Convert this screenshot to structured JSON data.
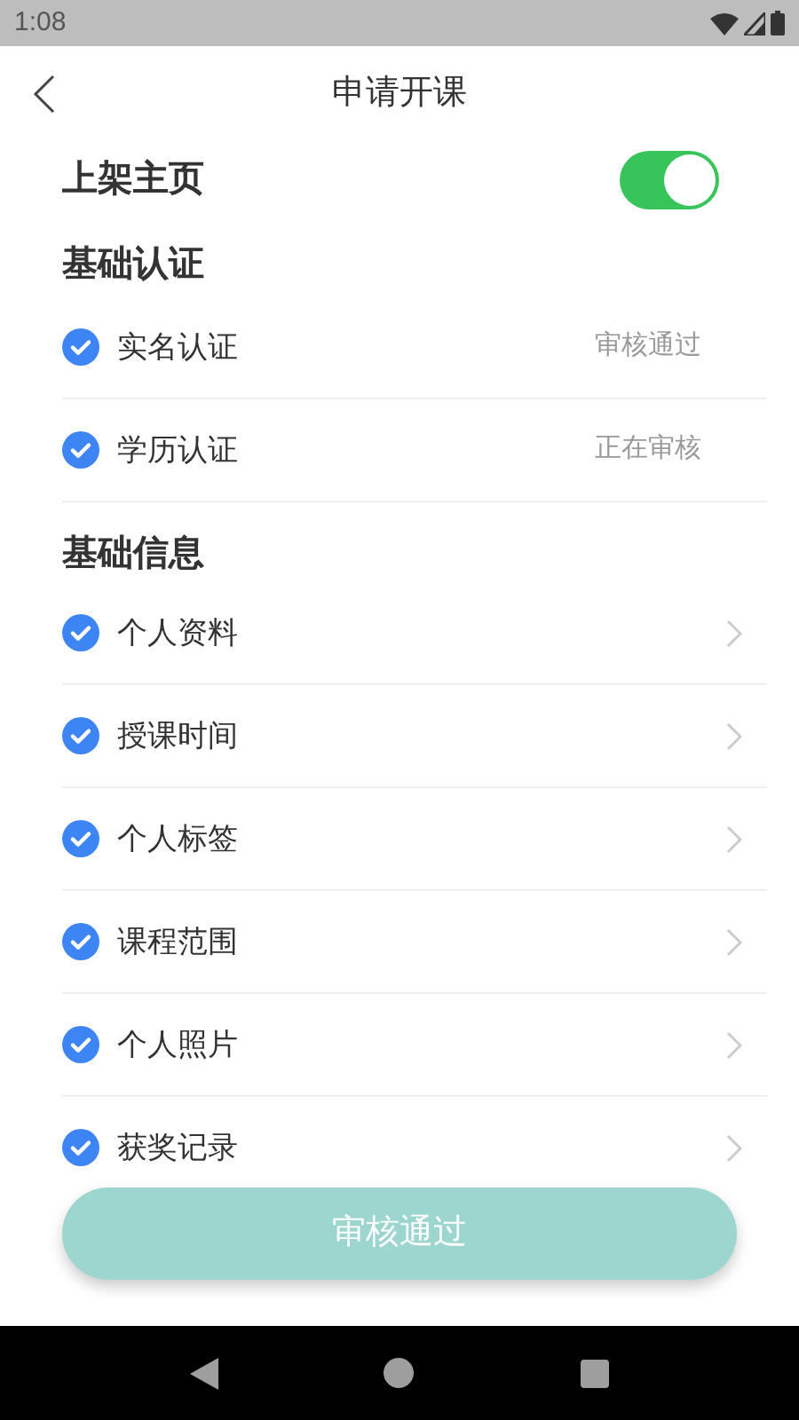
{
  "status_bar": {
    "time": "1:08"
  },
  "header": {
    "title": "申请开课"
  },
  "listing_toggle": {
    "label": "上架主页",
    "on": true
  },
  "sections": [
    {
      "title": "基础认证",
      "items": [
        {
          "label": "实名认证",
          "checked": true,
          "kind": "status",
          "status": "审核通过"
        },
        {
          "label": "学历认证",
          "checked": true,
          "kind": "status",
          "status": "正在审核"
        }
      ]
    },
    {
      "title": "基础信息",
      "items": [
        {
          "label": "个人资料",
          "checked": true,
          "kind": "link"
        },
        {
          "label": "授课时间",
          "checked": true,
          "kind": "link"
        },
        {
          "label": "个人标签",
          "checked": true,
          "kind": "link"
        },
        {
          "label": "课程范围",
          "checked": true,
          "kind": "link"
        },
        {
          "label": "个人照片",
          "checked": true,
          "kind": "link"
        },
        {
          "label": "获奖记录",
          "checked": true,
          "kind": "link"
        }
      ]
    }
  ],
  "submit_button": {
    "label": "审核通过"
  }
}
